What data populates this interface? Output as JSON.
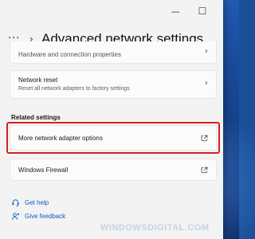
{
  "window": {
    "minimize_glyph": "—",
    "maximize_glyph": "☐",
    "title": "Advanced network settings",
    "more_glyph": "···",
    "chevron_glyph": "›"
  },
  "settings": {
    "partial_item": {
      "label": "Hardware and connection properties"
    },
    "network_reset": {
      "label": "Network reset",
      "description": "Reset all network adapters to factory settings"
    }
  },
  "related_settings": {
    "heading": "Related settings",
    "items": [
      {
        "label": "More network adapter options",
        "icon": "open-external-icon",
        "highlighted": true
      },
      {
        "label": "Windows Firewall",
        "icon": "open-external-icon",
        "highlighted": false
      }
    ]
  },
  "footer_links": [
    {
      "label": "Get help",
      "icon": "help-headset-icon"
    },
    {
      "label": "Give feedback",
      "icon": "feedback-person-icon"
    }
  ],
  "watermark": "WINDOWSDIGITAL.COM",
  "colors": {
    "highlight": "#d81e1e",
    "link": "#0a5cbd",
    "window_bg": "#f3f3f3",
    "card_bg": "#fbfbfb"
  }
}
